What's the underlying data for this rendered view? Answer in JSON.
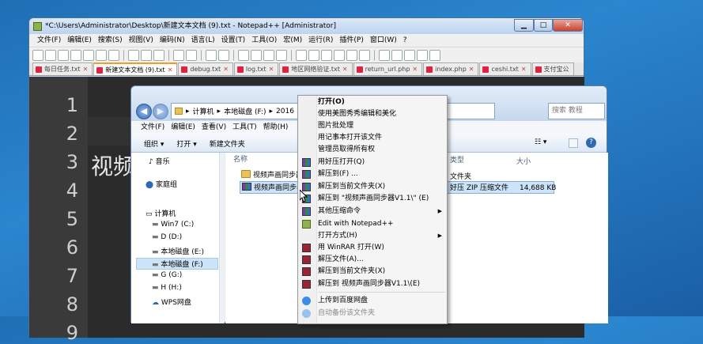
{
  "npp": {
    "title": "*C:\\Users\\Administrator\\Desktop\\新建文本文档 (9).txt - Notepad++ [Administrator]",
    "controls": {
      "minimize": "▁",
      "maximize": "□",
      "close": "✕"
    },
    "menu": [
      "文件(F)",
      "编辑(E)",
      "搜索(S)",
      "视图(V)",
      "编码(N)",
      "语言(L)",
      "设置(T)",
      "工具(O)",
      "宏(M)",
      "运行(R)",
      "插件(P)",
      "窗口(W)",
      "?"
    ],
    "tabs": [
      {
        "label": "每日任务.txt"
      },
      {
        "label": "新建文本文档 (9).txt"
      },
      {
        "label": "debug.txt"
      },
      {
        "label": "log.txt"
      },
      {
        "label": "地区网络验证.txt"
      },
      {
        "label": "return_url.php"
      },
      {
        "label": "index.php"
      },
      {
        "label": "ceshi.txt"
      },
      {
        "label": "支付宝公"
      }
    ],
    "line_numbers": [
      "1",
      "2",
      "3",
      "4",
      "5",
      "6",
      "7",
      "8",
      "9"
    ],
    "editor_text": "视频"
  },
  "explorer": {
    "back": "◀",
    "forward": "▶",
    "address": {
      "root": "计算机",
      "drive": "本地磁盘 (F:)",
      "folder": "2016"
    },
    "search_placeholder": "搜索 教程",
    "menu": [
      "文件(F)",
      "编辑(E)",
      "查看(V)",
      "工具(T)",
      "帮助(H)"
    ],
    "commands": {
      "organize": "组织 ▾",
      "open": "打开 ▾",
      "new_folder": "新建文件夹"
    },
    "sidebar": [
      {
        "label": "音乐"
      },
      {
        "label": "家庭组"
      },
      {
        "label": "计算机"
      },
      {
        "label": "Win7 (C:)"
      },
      {
        "label": "D (D:)"
      },
      {
        "label": "本地磁盘 (E:)"
      },
      {
        "label": "本地磁盘 (F:)"
      },
      {
        "label": "G (G:)"
      },
      {
        "label": "H (H:)"
      },
      {
        "label": "WPS网盘"
      }
    ],
    "columns": {
      "name": "名称",
      "type": "类型",
      "size": "大小"
    },
    "files": [
      {
        "name": "视频声画同步器",
        "type": "文件夹",
        "size": ""
      },
      {
        "name": "视频声画同步器",
        "type": "好压 ZIP 压缩文件",
        "size": "14,688 KB"
      }
    ]
  },
  "context_menu": {
    "items": [
      {
        "label": "打开(O)"
      },
      {
        "label": "使用美图秀秀编辑和美化"
      },
      {
        "label": "图片批处理"
      },
      {
        "label": "用记事本打开该文件"
      },
      {
        "label": "管理员取得所有权"
      },
      {
        "label": "用好压打开(Q)"
      },
      {
        "label": "解压到(F) ..."
      },
      {
        "label": "解压到当前文件夹(X)"
      },
      {
        "label": "解压到 \"视频声画同步器V1.1\\\" (E)"
      },
      {
        "label": "其他压缩命令"
      },
      {
        "label": "Edit with Notepad++"
      },
      {
        "label": "打开方式(H)"
      },
      {
        "label": "用 WinRAR 打开(W)"
      },
      {
        "label": "解压文件(A)..."
      },
      {
        "label": "解压到当前文件夹(X)"
      },
      {
        "label": "解压到 视频声画同步器V1.1\\(E)"
      },
      {
        "label": "上传到百度网盘"
      },
      {
        "label": "自动备份该文件夹"
      }
    ]
  }
}
